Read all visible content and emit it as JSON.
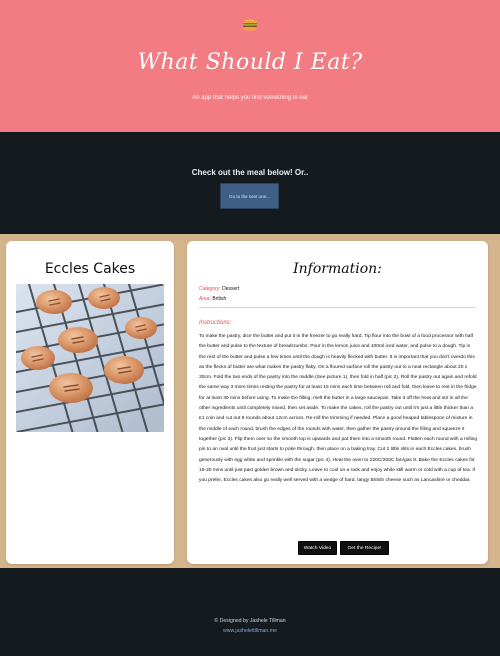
{
  "header": {
    "title": "What Should I Eat?",
    "subtitle": "An app that helps you find something to eat",
    "logo_icon": "burger-icon"
  },
  "cta": {
    "text": "Check out the meal below! Or..",
    "button_label": "Go to the next one..."
  },
  "meal": {
    "name": "Eccles Cakes",
    "image_label": "eccles-cakes-photo"
  },
  "information": {
    "title": "Information:",
    "category_label": "Category:",
    "category_value": "Dessert",
    "area_label": "Area:",
    "area_value": "British",
    "instructions_label": "Instructions:",
    "instructions_text": "To make the pastry, dice the butter and put it in the freezer to go really hard. Tip flour into the bowl of a food processor with half the butter and pulse to the texture of breadcrumbs. Pour in the lemon juice and 100ml iced water, and pulse to a dough. Tip in the rest of the butter and pulse a few times until the dough is heavily flecked with butter. It is important that you don't overdo this as the flecks of butter are what makes the pastry flaky. On a floured surface roll the pastry out to a neat rectangle about 20 x 30cm. Fold the two ends of the pastry into the middle (See picture 1), then fold in half (pic 2). Roll the pastry out again and refold the same way 3 more times resting the pastry for at least 15 mins each time between roll and fold, then leave to rest in the fridge for at least 30 mins before using. To make the filling, melt the butter in a large saucepan. Take it off the heat and stir in all the other ingredients until completely mixed, then set aside. To make the cakes, roll the pastry out until it's just a little thicker than a £1 coin and cut out 8 rounds about 12cm across. Re-roll the trimming if needed. Place a good heaped tablespoon of mixture in the middle of each round, brush the edges of the rounds with water, then gather the pastry around the filling and squeeze it together (pic 3). Flip them over so the smooth top is upwards and pat them into a smooth round. Flatten each round with a rolling pin to an oval until the fruit just starts to poke through, then place on a baking tray. Cut 2 little slits in each Eccles cakes, brush generously with egg white and sprinkle with the sugar (pic 4). Heat the oven to 220C/200C fan/gas 8. Bake the Eccles cakes for 15-20 mins until just past golden brown and sticky. Leave to cool on a rack and enjoy while still warm or cold with a cup of tea. If you prefer, Eccles cakes also go really well served with a wedge of hard, tangy British cheese such as Lancashire or cheddar.",
    "buttons": {
      "watch_video": "Watch Video",
      "get_recipe": "Get the Recipe!"
    }
  },
  "footer": {
    "designed_by": "© Designed by Jashele Tillman",
    "website": "www.jashelettillman.me"
  },
  "colors": {
    "header_bg": "#f37c83",
    "dark_bg": "#141a1e",
    "main_bg": "#d4b48a",
    "accent_red": "#e24d56",
    "cta_button": "#3f5f86"
  }
}
